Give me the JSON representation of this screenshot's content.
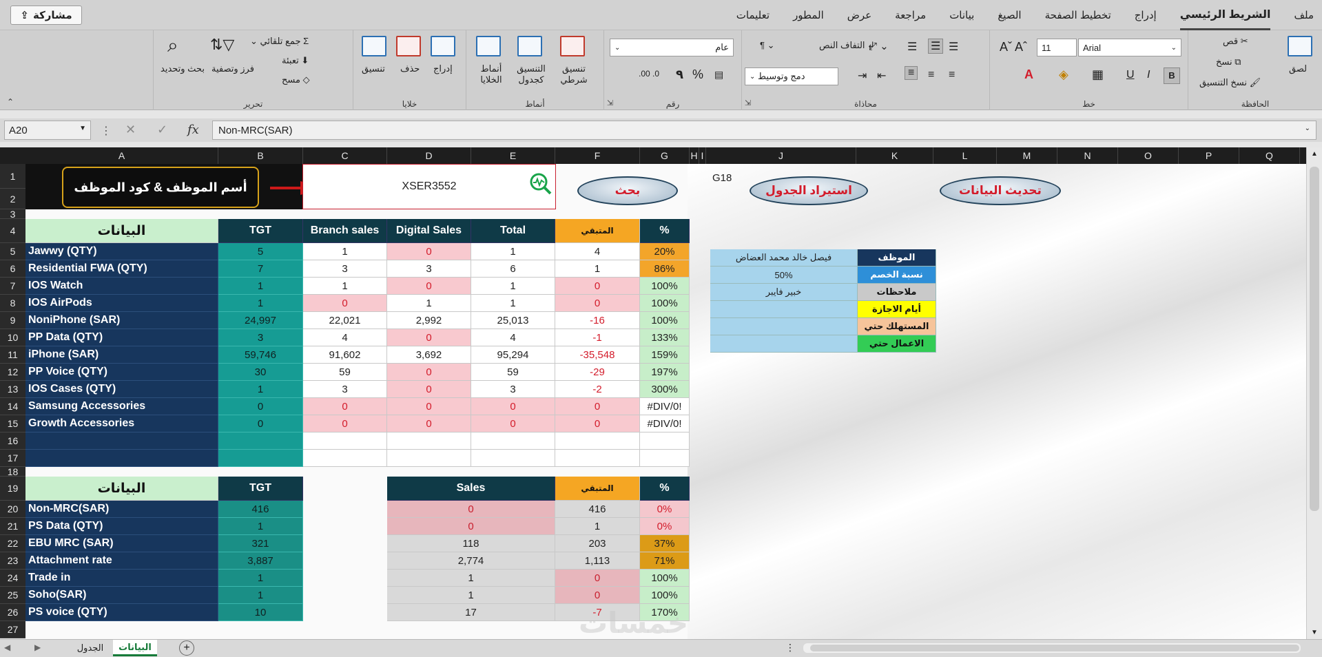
{
  "menu": {
    "share_label": "مشاركة",
    "tabs": [
      "ملف",
      "الشريط الرئيسي",
      "إدراج",
      "تخطيط الصفحة",
      "الصيغ",
      "بيانات",
      "مراجعة",
      "عرض",
      "المطور",
      "تعليمات"
    ],
    "active_tab": "الشريط الرئيسي"
  },
  "ribbon": {
    "clipboard": {
      "group": "الحافظة",
      "paste": "لصق",
      "cut": "قص",
      "copy": "نسخ",
      "format_painter": "نسخ التنسيق"
    },
    "font": {
      "group": "خط",
      "font_name": "Arial",
      "font_size": "11",
      "bold": "B",
      "italic": "I",
      "underline": "U"
    },
    "alignment": {
      "group": "محاذاة",
      "wrap_text": "التفاف النص",
      "merge_center": "دمج وتوسيط"
    },
    "number": {
      "group": "رقم",
      "format": "عام",
      "percent": "%",
      "comma": "٩"
    },
    "styles": {
      "group": "أنماط",
      "conditional": "تنسيق شرطي",
      "as_table": "التنسيق كجدول",
      "cell_styles": "أنماط الخلايا"
    },
    "cells": {
      "group": "خلايا",
      "insert": "إدراج",
      "delete": "حذف",
      "format": "تنسيق"
    },
    "editing": {
      "group": "تحرير",
      "autosum": "جمع تلقائي",
      "fill": "تعبئة",
      "clear": "مسح",
      "sort_filter": "فرز وتصفية",
      "find_select": "بحث وتحديد"
    }
  },
  "formula_bar": {
    "name_box": "A20",
    "formula": "Non-MRC(SAR)",
    "fx": "fx"
  },
  "columns": [
    "A",
    "B",
    "C",
    "D",
    "E",
    "F",
    "G",
    "H",
    "I",
    "J",
    "K",
    "L",
    "M",
    "N",
    "O",
    "P",
    "Q"
  ],
  "rows": [
    "1",
    "2",
    "3",
    "4",
    "5",
    "6",
    "7",
    "8",
    "9",
    "10",
    "11",
    "12",
    "13",
    "14",
    "15",
    "16",
    "17",
    "18",
    "19",
    "20",
    "21",
    "22",
    "23",
    "24",
    "25",
    "26",
    "27"
  ],
  "header_area": {
    "employee_label": "أسم الموظف & كود الموظف",
    "employee_code": "XSER3552",
    "search_button": "بحث",
    "import_button": "استيراد الجدول",
    "update_button": "تحديث البيانات",
    "cell_ref": "G18"
  },
  "table1": {
    "headers": [
      "البيانات",
      "TGT",
      "Branch sales",
      "Digital Sales",
      "Total",
      "المتبقي",
      "%"
    ],
    "rows": [
      {
        "label": "Jawwy (QTY)",
        "tgt": "5",
        "branch": "1",
        "digital": "0",
        "total": "1",
        "remaining": "4",
        "pct": "20%"
      },
      {
        "label": "Residential FWA (QTY)",
        "tgt": "7",
        "branch": "3",
        "digital": "3",
        "total": "6",
        "remaining": "1",
        "pct": "86%"
      },
      {
        "label": "IOS Watch",
        "tgt": "1",
        "branch": "1",
        "digital": "0",
        "total": "1",
        "remaining": "0",
        "pct": "100%"
      },
      {
        "label": "IOS AirPods",
        "tgt": "1",
        "branch": "0",
        "digital": "1",
        "total": "1",
        "remaining": "0",
        "pct": "100%"
      },
      {
        "label": "NoniPhone (SAR)",
        "tgt": "24,997",
        "branch": "22,021",
        "digital": "2,992",
        "total": "25,013",
        "remaining": "-16",
        "pct": "100%"
      },
      {
        "label": "PP Data (QTY)",
        "tgt": "3",
        "branch": "4",
        "digital": "0",
        "total": "4",
        "remaining": "-1",
        "pct": "133%"
      },
      {
        "label": "iPhone (SAR)",
        "tgt": "59,746",
        "branch": "91,602",
        "digital": "3,692",
        "total": "95,294",
        "remaining": "-35,548",
        "pct": "159%"
      },
      {
        "label": "PP Voice (QTY)",
        "tgt": "30",
        "branch": "59",
        "digital": "0",
        "total": "59",
        "remaining": "-29",
        "pct": "197%"
      },
      {
        "label": "IOS Cases (QTY)",
        "tgt": "1",
        "branch": "3",
        "digital": "0",
        "total": "3",
        "remaining": "-2",
        "pct": "300%"
      },
      {
        "label": "Samsung Accessories",
        "tgt": "0",
        "branch": "0",
        "digital": "0",
        "total": "0",
        "remaining": "0",
        "pct": "#DIV/0!"
      },
      {
        "label": "Growth Accessories",
        "tgt": "0",
        "branch": "0",
        "digital": "0",
        "total": "0",
        "remaining": "0",
        "pct": "#DIV/0!"
      },
      {
        "label": "",
        "tgt": "",
        "branch": "",
        "digital": "",
        "total": "",
        "remaining": "",
        "pct": ""
      },
      {
        "label": "",
        "tgt": "",
        "branch": "",
        "digital": "",
        "total": "",
        "remaining": "",
        "pct": ""
      }
    ]
  },
  "table2": {
    "headers": [
      "البيانات",
      "TGT",
      "Sales",
      "المتبقي",
      "%"
    ],
    "rows": [
      {
        "label": "Non-MRC(SAR)",
        "tgt": "416",
        "sales": "0",
        "remaining": "416",
        "pct": "0%"
      },
      {
        "label": "PS Data (QTY)",
        "tgt": "1",
        "sales": "0",
        "remaining": "1",
        "pct": "0%"
      },
      {
        "label": "EBU MRC (SAR)",
        "tgt": "321",
        "sales": "118",
        "remaining": "203",
        "pct": "37%"
      },
      {
        "label": "Attachment rate",
        "tgt": "3,887",
        "sales": "2,774",
        "remaining": "1,113",
        "pct": "71%"
      },
      {
        "label": "Trade in",
        "tgt": "1",
        "sales": "1",
        "remaining": "0",
        "pct": "100%"
      },
      {
        "label": "Soho(SAR)",
        "tgt": "1",
        "sales": "1",
        "remaining": "0",
        "pct": "100%"
      },
      {
        "label": "PS voice (QTY)",
        "tgt": "10",
        "sales": "17",
        "remaining": "-7",
        "pct": "170%"
      }
    ]
  },
  "info_panel": [
    {
      "label": "الموظف",
      "value": "فيصل خالد محمد العضاض",
      "color": "#17365d"
    },
    {
      "label": "نسبة الخصم",
      "value": "50%",
      "color": "#2e8fd8"
    },
    {
      "label": "ملاحظات",
      "value": "خبير فايبر",
      "color": "#c9c9c9"
    },
    {
      "label": "أيام الاجازة",
      "value": "",
      "color": "#ffff00"
    },
    {
      "label": "المستهلك حتي",
      "value": "",
      "color": "#f6c49a"
    },
    {
      "label": "الاعمال حتي",
      "value": "",
      "color": "#33cc55"
    }
  ],
  "sheets": {
    "active": "البيانات",
    "other": "الجدول"
  },
  "watermark": "خمسات"
}
